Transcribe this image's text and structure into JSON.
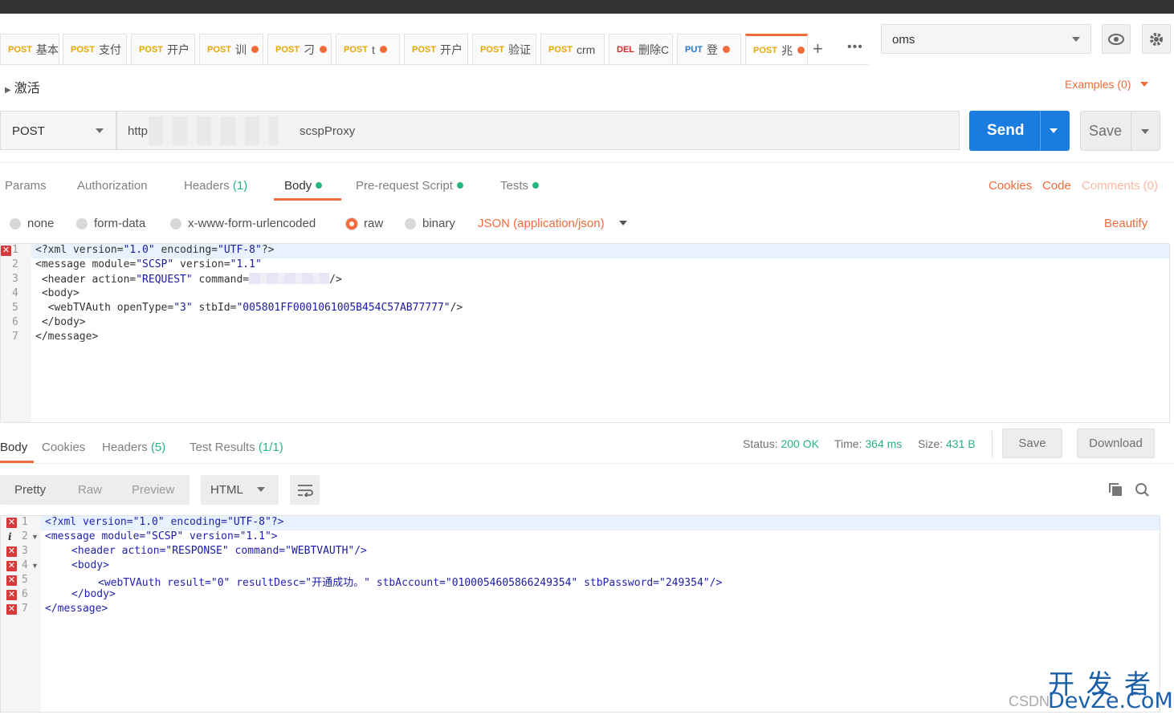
{
  "tabs": [
    {
      "method": "POST",
      "name": "基本",
      "dot": false
    },
    {
      "method": "POST",
      "name": "支付",
      "dot": false
    },
    {
      "method": "POST",
      "name": "开户",
      "dot": false
    },
    {
      "method": "POST",
      "name": "训",
      "dot": true
    },
    {
      "method": "POST",
      "name": "刁",
      "dot": true
    },
    {
      "method": "POST",
      "name": "t",
      "dot": true
    },
    {
      "method": "POST",
      "name": "开户",
      "dot": false
    },
    {
      "method": "POST",
      "name": "验证",
      "dot": false
    },
    {
      "method": "POST",
      "name": "crm",
      "dot": false
    },
    {
      "method": "DEL",
      "name": "删除C",
      "dot": false
    },
    {
      "method": "PUT",
      "name": "登",
      "dot": true
    },
    {
      "method": "POST",
      "name": "兆",
      "dot": true
    }
  ],
  "env": {
    "selected": "oms"
  },
  "request": {
    "name": "激活",
    "examples_label": "Examples (0)",
    "method": "POST",
    "url_start": "http",
    "url_end": "scspProxy",
    "send_label": "Send",
    "save_label": "Save"
  },
  "req_tabs": {
    "params": "Params",
    "authorization": "Authorization",
    "headers": "Headers",
    "headers_count": "(1)",
    "body": "Body",
    "prerequest": "Pre-request Script",
    "tests": "Tests",
    "cookies": "Cookies",
    "code": "Code",
    "comments": "Comments (0)"
  },
  "body_types": {
    "none": "none",
    "form_data": "form-data",
    "urlencoded": "x-www-form-urlencoded",
    "raw": "raw",
    "binary": "binary",
    "raw_type": "JSON (application/json)",
    "beautify": "Beautify"
  },
  "request_code": {
    "line_numbers": [
      "1",
      "2",
      "3",
      "4",
      "5",
      "6",
      "7"
    ],
    "l1": [
      "<?xml version=",
      "\"1.0\"",
      " encoding=",
      "\"UTF-8\"",
      "?>"
    ],
    "l2": [
      "<message module=",
      "\"SCSP\"",
      " version=",
      "\"1.1\""
    ],
    "l3": [
      " <header action=",
      "\"REQUEST\"",
      " command=",
      "/>"
    ],
    "l4": " <body>",
    "l5": [
      "  <webTVAuth openType=",
      "\"3\"",
      " stbId=",
      "\"005801FF0001061005B454C57AB77777\"",
      "/>"
    ],
    "l6": " </body>",
    "l7": "</message>"
  },
  "response": {
    "tabs": {
      "body": "Body",
      "cookies": "Cookies",
      "headers": "Headers",
      "headers_count": "(5)",
      "tests": "Test Results",
      "tests_count": "(1/1)"
    },
    "status_label": "Status:",
    "status_value": "200 OK",
    "time_label": "Time:",
    "time_value": "364 ms",
    "size_label": "Size:",
    "size_value": "431 B",
    "save_label": "Save",
    "download_label": "Download",
    "view_pretty": "Pretty",
    "view_raw": "Raw",
    "view_preview": "Preview",
    "format": "HTML"
  },
  "response_code": {
    "line_numbers": [
      "1",
      "2",
      "3",
      "4",
      "5",
      "6",
      "7"
    ],
    "l1": [
      "<?xml version=",
      "\"1.0\"",
      " encoding=",
      "\"UTF-8\"",
      "?>"
    ],
    "l2": [
      "<message module=",
      "\"SCSP\"",
      " version=",
      "\"1.1\"",
      ">"
    ],
    "l3": [
      "<header action=",
      "\"RESPONSE\"",
      " command=",
      "\"WEBTVAUTH\"",
      "/>"
    ],
    "l4": "<body>",
    "l5": [
      "<webTVAuth result=",
      "\"0\"",
      " resultDesc=",
      "\"开通成功。\"",
      " stbAccount=",
      "\"0100054605866249354\"",
      " stbPassword=",
      "\"249354\"",
      "/>"
    ],
    "l6": "</body>",
    "l7": "</message>"
  },
  "watermark": {
    "top": "开 发 者",
    "bottom": "DevZe.CoM",
    "csdn": "CSDN"
  }
}
